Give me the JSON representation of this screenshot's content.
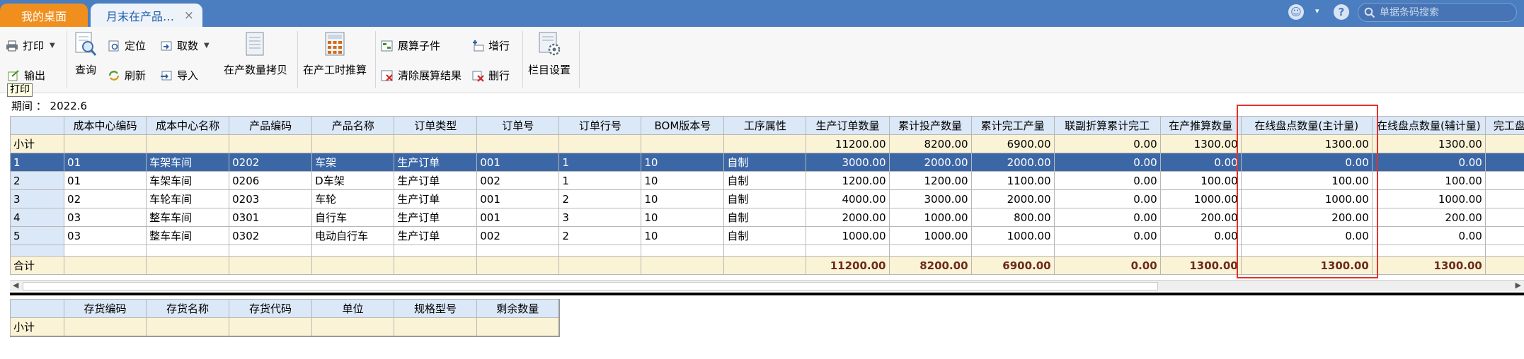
{
  "tabs": {
    "home": "我的桌面",
    "wip": "月末在产品…",
    "close": "×"
  },
  "topbar": {
    "search_placeholder": "单据条码搜索",
    "caret": "▾",
    "help": "?"
  },
  "toolbar": {
    "print": "打印",
    "locate": "定位",
    "fetch": "取数",
    "export": "输出",
    "query": "查询",
    "refresh": "刷新",
    "import": "导入",
    "wip_copy": "在产数量拷贝",
    "wip_hours": "在产工时推算",
    "expand_child": "展算子件",
    "clear_expand": "清除展算结果",
    "add_row": "增行",
    "delete_row": "删行",
    "column_settings": "栏目设置",
    "tooltip": "打印"
  },
  "period": {
    "label": "期间 ： 2022.6"
  },
  "grid": {
    "headers": [
      "",
      "成本中心编码",
      "成本中心名称",
      "产品编码",
      "产品名称",
      "订单类型",
      "订单号",
      "订单行号",
      "BOM版本号",
      "工序属性",
      "生产订单数量",
      "累计投产数量",
      "累计完工产量",
      "联副折算累计完工",
      "在产推算数量",
      "在线盘点数量(主计量)",
      "在线盘点数量(辅计量)",
      "完工盘"
    ],
    "subtotal": [
      "小计",
      "",
      "",
      "",
      "",
      "",
      "",
      "",
      "",
      "",
      "11200.00",
      "8200.00",
      "6900.00",
      "0.00",
      "1300.00",
      "1300.00",
      "1300.00",
      ""
    ],
    "rows": [
      [
        "1",
        "01",
        "车架车间",
        "0202",
        "车架",
        "生产订单",
        "001",
        "1",
        "10",
        "自制",
        "3000.00",
        "2000.00",
        "2000.00",
        "0.00",
        "0.00",
        "0.00",
        "0.00",
        ""
      ],
      [
        "2",
        "01",
        "车架车间",
        "0206",
        "D车架",
        "生产订单",
        "002",
        "1",
        "10",
        "自制",
        "1200.00",
        "1200.00",
        "1100.00",
        "0.00",
        "100.00",
        "100.00",
        "100.00",
        ""
      ],
      [
        "3",
        "02",
        "车轮车间",
        "0203",
        "车轮",
        "生产订单",
        "001",
        "2",
        "10",
        "自制",
        "4000.00",
        "3000.00",
        "2000.00",
        "0.00",
        "1000.00",
        "1000.00",
        "1000.00",
        ""
      ],
      [
        "4",
        "03",
        "整车车间",
        "0301",
        "自行车",
        "生产订单",
        "001",
        "3",
        "10",
        "自制",
        "2000.00",
        "1000.00",
        "800.00",
        "0.00",
        "200.00",
        "200.00",
        "200.00",
        ""
      ],
      [
        "5",
        "03",
        "整车车间",
        "0302",
        "电动自行车",
        "生产订单",
        "002",
        "2",
        "10",
        "自制",
        "1000.00",
        "1000.00",
        "1000.00",
        "0.00",
        "0.00",
        "0.00",
        "0.00",
        ""
      ]
    ],
    "total": [
      "合计",
      "",
      "",
      "",
      "",
      "",
      "",
      "",
      "",
      "",
      "11200.00",
      "8200.00",
      "6900.00",
      "0.00",
      "1300.00",
      "1300.00",
      "1300.00",
      ""
    ]
  },
  "grid2": {
    "headers": [
      "",
      "存货编码",
      "存货名称",
      "存货代码",
      "单位",
      "规格型号",
      "剩余数量"
    ],
    "subtotal": [
      "小计",
      "",
      "",
      "",
      "",
      "",
      ""
    ]
  },
  "colors": {
    "tabbar": "#4a7ec0",
    "home_tab": "#f08f1e",
    "selected_row": "#3c67a6",
    "subtotal_bg": "#fbf3d6",
    "header_bg": "#dbe8f7",
    "highlight_box": "#e3312d"
  }
}
